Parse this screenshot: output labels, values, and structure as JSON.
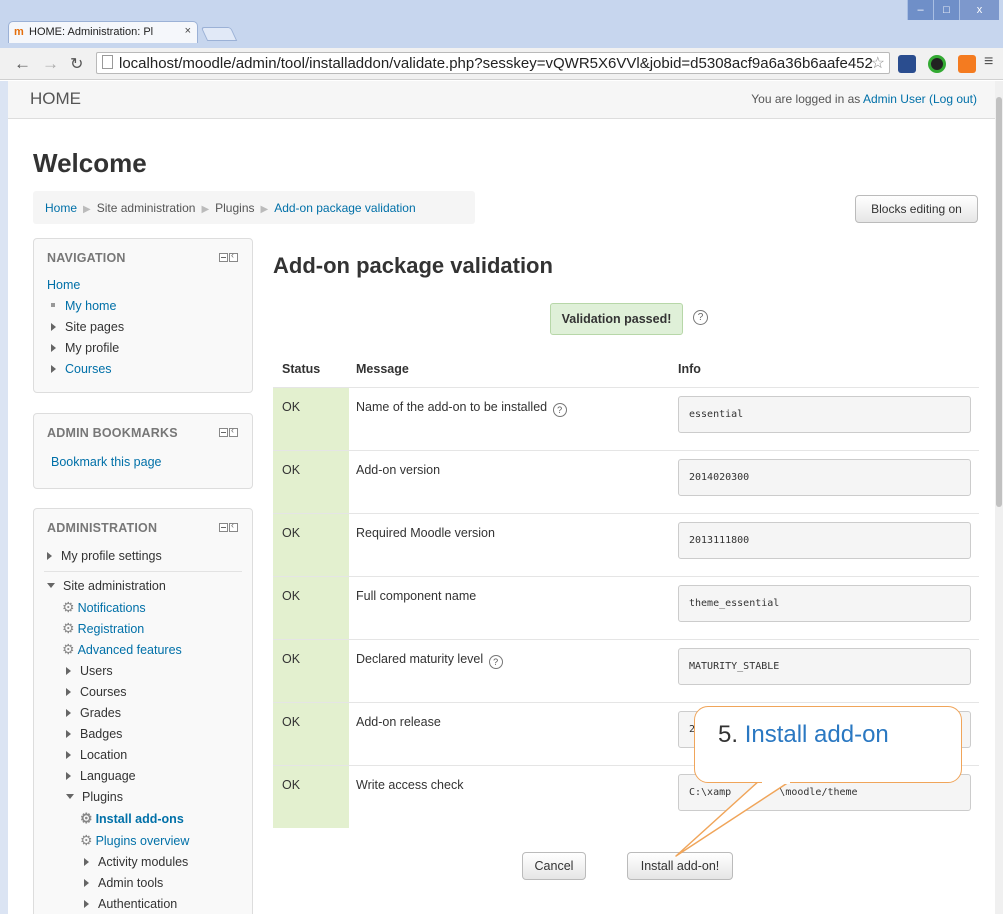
{
  "browser": {
    "tab_title": "HOME: Administration: Pl",
    "tab_close": "×",
    "favicon": "m",
    "url": "localhost/moodle/admin/tool/installaddon/validate.php?sesskey=vQWR5X6VVl&jobid=d5308acf9a6a36b6aafe452",
    "window_controls": [
      "–",
      "□",
      "x"
    ]
  },
  "header": {
    "site_name": "HOME",
    "login_prefix": "You are logged in as ",
    "user_name": "Admin User",
    "logout_label": "(Log out)"
  },
  "page": {
    "heading": "Welcome",
    "breadcrumb": [
      "Home",
      "Site administration",
      "Plugins",
      "Add-on package validation"
    ],
    "blocks_editing_label": "Blocks editing on"
  },
  "navigation": {
    "title": "NAVIGATION",
    "home": "Home",
    "items": [
      "My home",
      "Site pages",
      "My profile",
      "Courses"
    ]
  },
  "admin_bookmarks": {
    "title": "ADMIN BOOKMARKS",
    "link": "Bookmark this page"
  },
  "administration": {
    "title": "ADMINISTRATION",
    "my_profile_settings": "My profile settings",
    "site_administration": "Site administration",
    "gear_items": [
      "Notifications",
      "Registration",
      "Advanced features"
    ],
    "collapsed_items": [
      "Users",
      "Courses",
      "Grades",
      "Badges",
      "Location",
      "Language"
    ],
    "plugins": "Plugins",
    "install_addons": "Install add-ons",
    "plugins_overview": "Plugins overview",
    "plugin_subitems": [
      "Activity modules",
      "Admin tools",
      "Authentication"
    ]
  },
  "main": {
    "heading": "Add-on package validation",
    "validation_status": "Validation passed!",
    "help_glyph": "?",
    "columns": [
      "Status",
      "Message",
      "Info"
    ],
    "rows": [
      {
        "status": "OK",
        "message": "Name of the add-on to be installed",
        "help": true,
        "info": "essential"
      },
      {
        "status": "OK",
        "message": "Add-on version",
        "help": false,
        "info": "2014020300"
      },
      {
        "status": "OK",
        "message": "Required Moodle version",
        "help": false,
        "info": "2013111800"
      },
      {
        "status": "OK",
        "message": "Full component name",
        "help": false,
        "info": "theme_essential"
      },
      {
        "status": "OK",
        "message": "Declared maturity level",
        "help": true,
        "info": "MATURITY_STABLE"
      },
      {
        "status": "OK",
        "message": "Add-on release",
        "help": false,
        "info": "2"
      },
      {
        "status": "OK",
        "message": "Write access check",
        "help": false,
        "info": "C:\\xamp        \\moodle/theme"
      }
    ],
    "cancel_label": "Cancel",
    "install_label": "Install add-on!"
  },
  "callout": {
    "number": "5.",
    "text": "Install add-on",
    "number_color": "#333333",
    "text_color": "#2a78c2",
    "border_color": "#f0a55a"
  },
  "colors": {
    "link": "#0070a8",
    "status_ok_bg": "#e3f0cf",
    "validation_bg": "#dff0d8"
  }
}
